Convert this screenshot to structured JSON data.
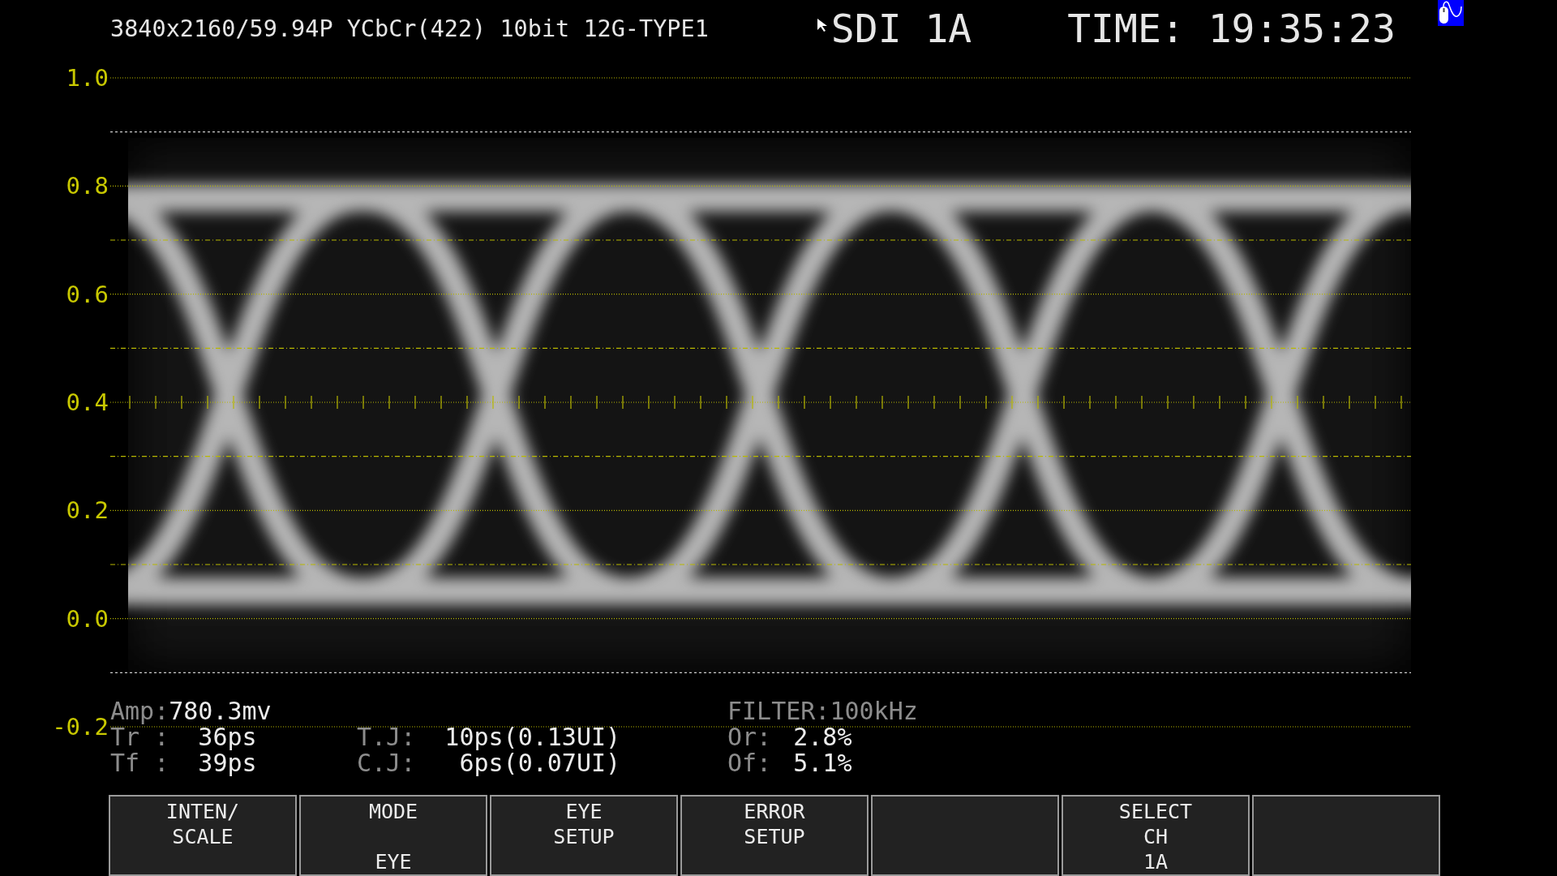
{
  "header": {
    "format": "3840x2160/59.94P YCbCr(422) 10bit 12G-TYPE1",
    "input": "SDI 1A",
    "time_label": "TIME:",
    "time": "19:35:23"
  },
  "scale_labels": [
    "1.0",
    "0.8",
    "0.6",
    "0.4",
    "0.2",
    "0.0",
    "-0.2"
  ],
  "measurements": {
    "amplitude": {
      "label": "Amp:",
      "value": "780.3mv"
    },
    "filter": "FILTER:100kHz",
    "rows": [
      [
        {
          "label": "Tr :",
          "value": "36ps"
        },
        {
          "label": "T.J:",
          "value": "10ps(0.13UI)"
        },
        {
          "label": "Or:",
          "value": "2.8%"
        }
      ],
      [
        {
          "label": "Tf :",
          "value": "39ps"
        },
        {
          "label": "C.J:",
          "value": "6ps(0.07UI)"
        },
        {
          "label": "Of:",
          "value": "5.1%"
        }
      ]
    ]
  },
  "softkeys": [
    {
      "kind": "label",
      "lines": [
        "INTEN/",
        "SCALE"
      ]
    },
    {
      "kind": "label",
      "lines": [
        "MODE"
      ],
      "value": "EYE"
    },
    {
      "kind": "label",
      "lines": [
        "EYE",
        "SETUP"
      ]
    },
    {
      "kind": "label",
      "lines": [
        "ERROR",
        "SETUP"
      ]
    },
    {
      "kind": "blank"
    },
    {
      "kind": "label",
      "lines": [
        "SELECT",
        "CH",
        "1A"
      ]
    },
    {
      "kind": "blank"
    }
  ]
}
